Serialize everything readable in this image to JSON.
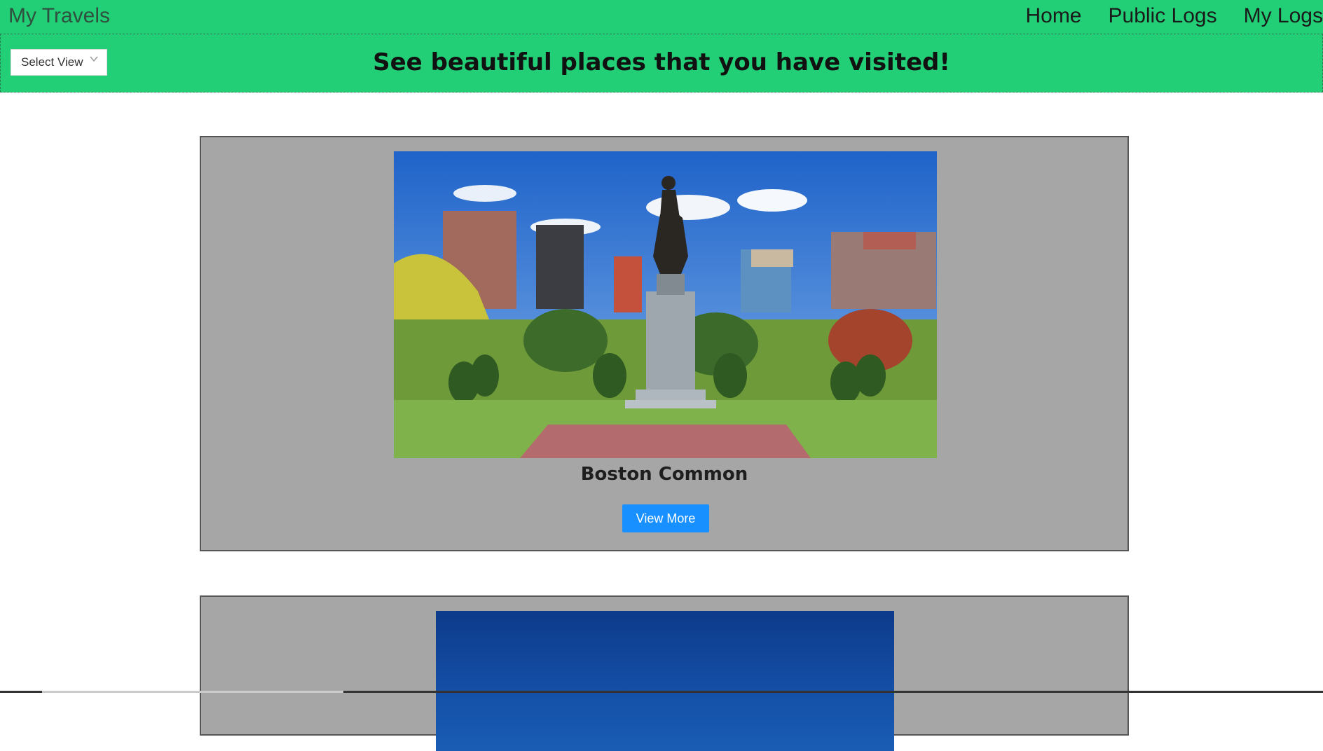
{
  "header": {
    "brand": "My Travels",
    "nav": [
      "Home",
      "Public Logs",
      "My Logs"
    ]
  },
  "toolbar": {
    "select_label": "Select View",
    "headline": "See beautiful places that you have visited!"
  },
  "cards": [
    {
      "title": "Boston Common",
      "button": "View More"
    }
  ],
  "colors": {
    "header_bg": "#22cf76",
    "card_bg": "#a6a6a6",
    "button_bg": "#1890ff"
  }
}
